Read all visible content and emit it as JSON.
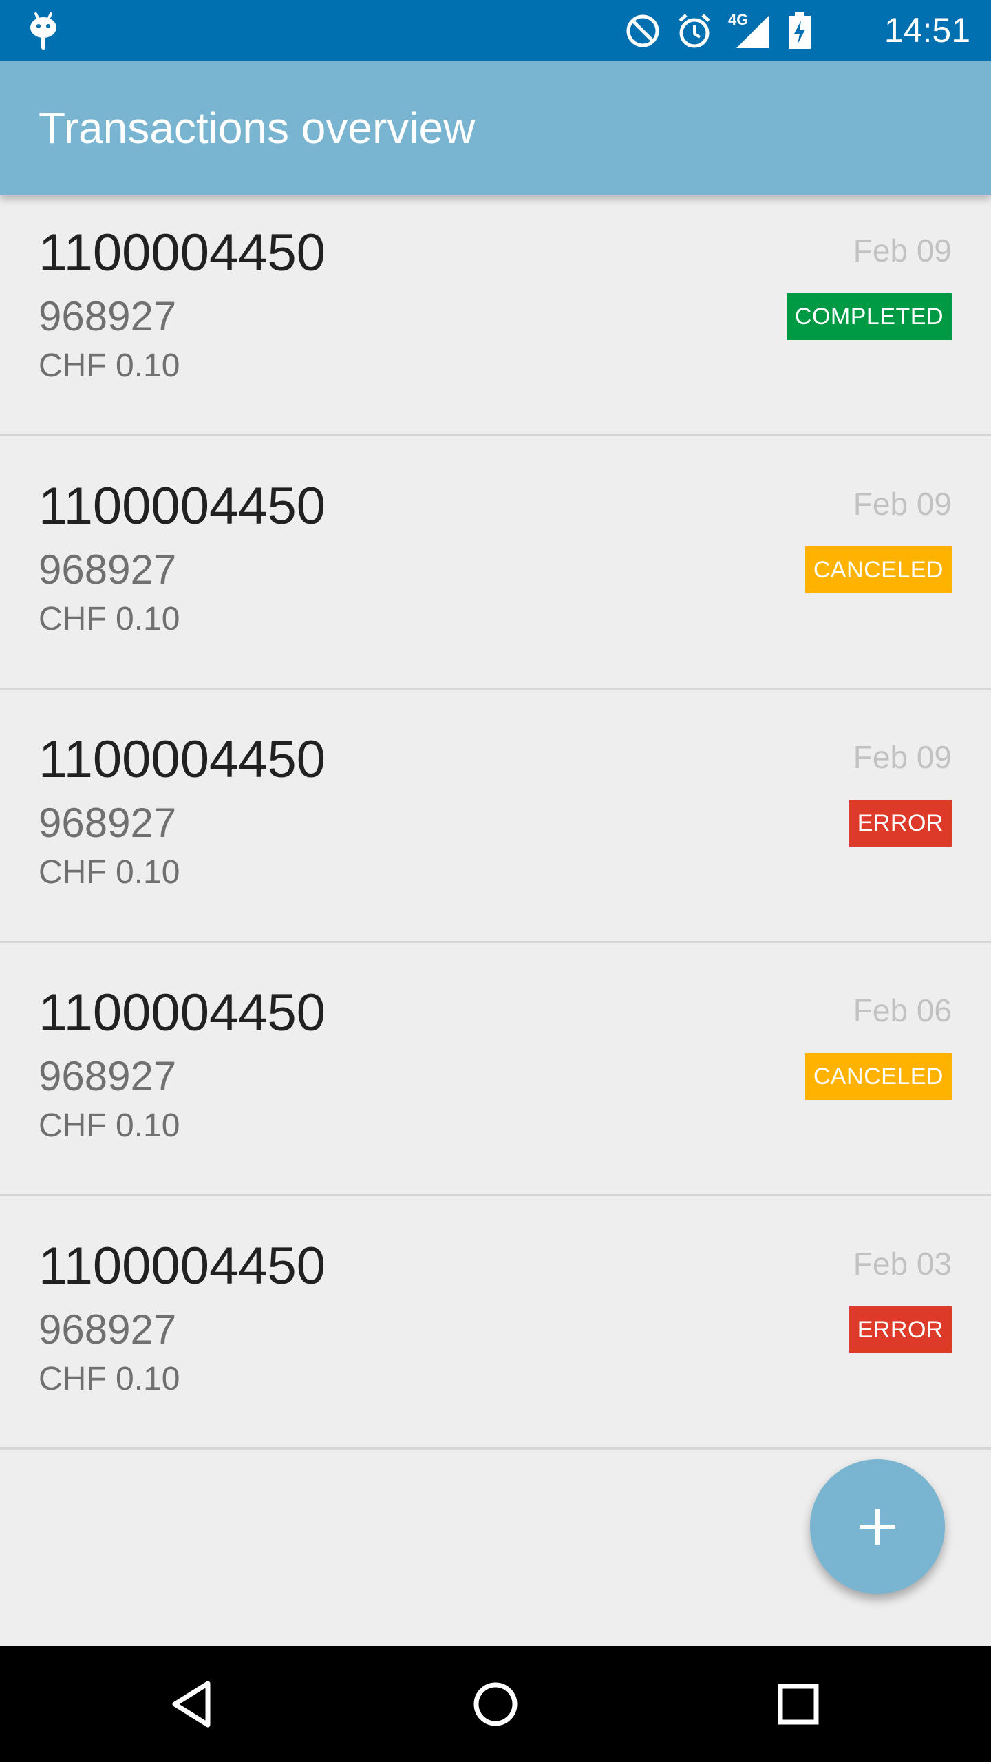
{
  "status_bar": {
    "time": "14:51",
    "network": "4G",
    "icons": [
      "android-debug-icon",
      "do-not-disturb-icon",
      "alarm-icon",
      "signal-icon",
      "battery-charging-icon"
    ],
    "background": "#0070b0"
  },
  "app_bar": {
    "title": "Transactions overview",
    "background": "#79b4d0"
  },
  "status_colors": {
    "CANCELED": "#ffb300",
    "COMPLETED": "#009a44",
    "ERROR": "#dd3a2a"
  },
  "transactions": [
    {
      "number": "1100004450",
      "code": "968927",
      "amount": "CHF 0.10",
      "date": "",
      "status": "CANCELED"
    },
    {
      "number": "1100004450",
      "code": "968927",
      "amount": "CHF 0.10",
      "date": "Feb 09",
      "status": "COMPLETED"
    },
    {
      "number": "1100004450",
      "code": "968927",
      "amount": "CHF 0.10",
      "date": "Feb 09",
      "status": "CANCELED"
    },
    {
      "number": "1100004450",
      "code": "968927",
      "amount": "CHF 0.10",
      "date": "Feb 09",
      "status": "ERROR"
    },
    {
      "number": "1100004450",
      "code": "968927",
      "amount": "CHF 0.10",
      "date": "Feb 06",
      "status": "CANCELED"
    },
    {
      "number": "1100004450",
      "code": "968927",
      "amount": "CHF 0.10",
      "date": "Feb 03",
      "status": "ERROR"
    }
  ],
  "fab": {
    "icon": "plus-icon"
  },
  "nav_bar": {
    "icons": [
      "back-icon",
      "home-icon",
      "recents-icon"
    ]
  }
}
